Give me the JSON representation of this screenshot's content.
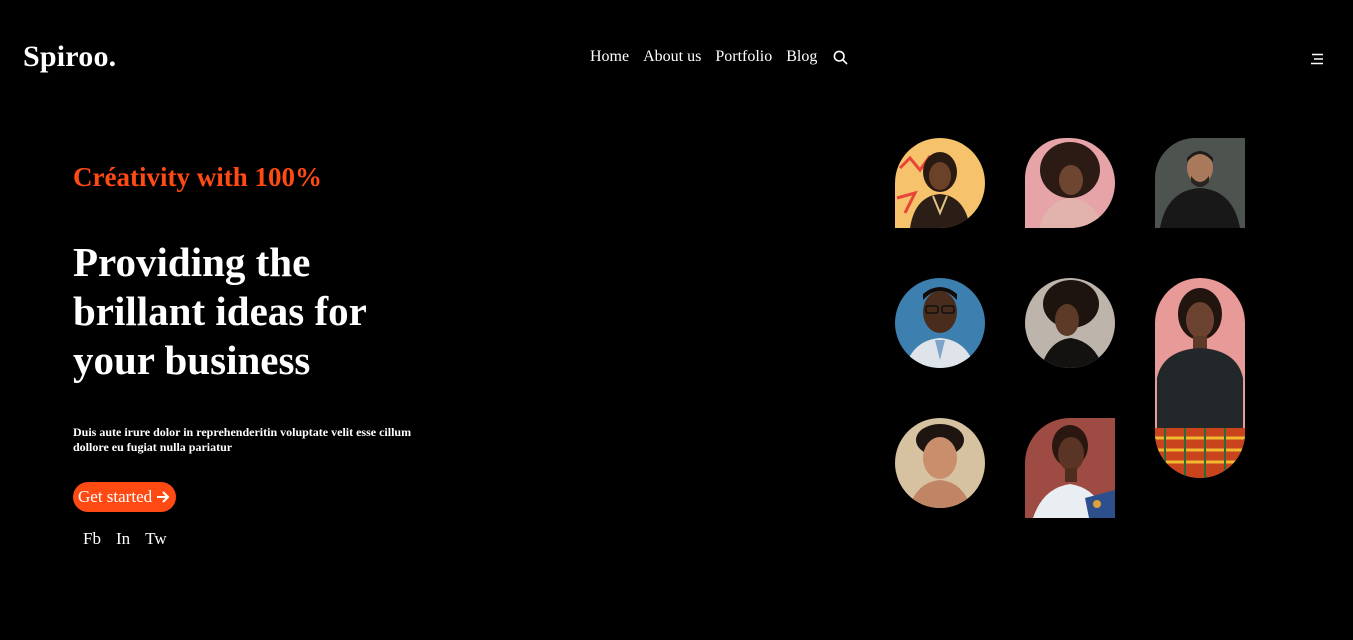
{
  "brand": {
    "logo": "Spiroo."
  },
  "nav": {
    "items": [
      "Home",
      "About us",
      "Portfolio",
      "Blog"
    ],
    "search_icon": "search-icon",
    "menu_icon": "hamburger-menu-icon"
  },
  "hero": {
    "tagline": "Créativity with 100%",
    "headline": "Providing the brillant ideas for your business",
    "description": "Duis aute irure dolor in reprehenderitin voluptate velit esse cillum dollore eu fugiat nulla pariatur",
    "cta_label": "Get started",
    "cta_icon": "arrow-right-icon"
  },
  "socials": [
    "Fb",
    "In",
    "Tw"
  ],
  "colors": {
    "background": "#000000",
    "accent": "#ff4a14",
    "text": "#ffffff"
  },
  "gallery": [
    {
      "id": "portrait-1",
      "bg": "#f6c26b"
    },
    {
      "id": "portrait-2",
      "bg": "#e6a4a8"
    },
    {
      "id": "portrait-3",
      "bg": "#4d5450"
    },
    {
      "id": "portrait-4",
      "bg": "#3d7fae"
    },
    {
      "id": "portrait-5",
      "bg": "#bdb4ab"
    },
    {
      "id": "portrait-6",
      "bg": "#e79a98"
    },
    {
      "id": "portrait-7",
      "bg": "#d6c2a1"
    },
    {
      "id": "portrait-8",
      "bg": "#9e4b43"
    }
  ]
}
